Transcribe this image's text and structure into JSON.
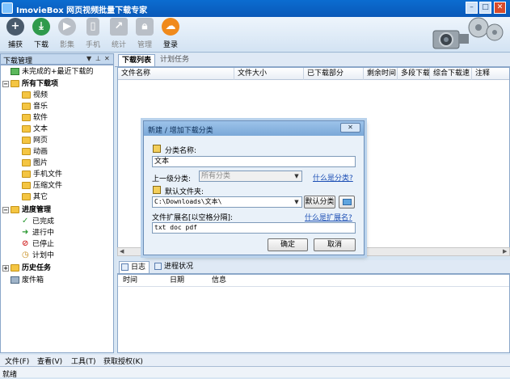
{
  "window": {
    "title": "ImovieBox 网页视频批量下载专家"
  },
  "toolbar": {
    "buttons": [
      {
        "label": "捕获",
        "icon": "plus-icon",
        "color": "#4a5a6b"
      },
      {
        "label": "下载",
        "icon": "download-icon",
        "color": "#2f9a4c"
      },
      {
        "label": "影集",
        "icon": "play-icon",
        "color": "#b9bfc7"
      },
      {
        "label": "手机",
        "icon": "phone-icon",
        "color": "#b9bfc7"
      },
      {
        "label": "统计",
        "icon": "chart-icon",
        "color": "#b9bfc7"
      },
      {
        "label": "管理",
        "icon": "lock-icon",
        "color": "#b9bfc7"
      },
      {
        "label": "登录",
        "icon": "cloud-icon",
        "color": "#f08a1c"
      }
    ]
  },
  "left_panel": {
    "title": "下载管理",
    "tree": {
      "unfinished": "未完成的+最近下载的",
      "all": "所有下载项",
      "categories": [
        "视频",
        "音乐",
        "软件",
        "文本",
        "网页",
        "动画",
        "图片",
        "手机文件",
        "压缩文件",
        "其它"
      ],
      "progress": "进度管理",
      "progress_items": [
        "已完成",
        "进行中",
        "已停止",
        "计划中"
      ],
      "history": "历史任务",
      "trash": "废件箱"
    }
  },
  "main": {
    "tabs": [
      "下载列表",
      "计划任务"
    ],
    "columns": [
      "文件名称",
      "文件大小",
      "已下载部分",
      "剩余时间",
      "多段下载",
      "综合下载速",
      "注释"
    ]
  },
  "bottom": {
    "tabs": [
      "日志",
      "进程状况"
    ],
    "columns": [
      "时间",
      "日期",
      "信息"
    ]
  },
  "menubar": [
    "文件(F)",
    "查看(V)",
    "工具(T)",
    "获取授权(K)"
  ],
  "status": "就绪",
  "dialog": {
    "title": "新建 / 增加下载分类",
    "category_name_label": "分类名称:",
    "category_name_value": "文本",
    "parent_label": "上一级分类:",
    "parent_value": "所有分类",
    "what_category_link": "什么是分类?",
    "default_folder_label": "默认文件夹:",
    "default_folder_value": "C:\\Downloads\\文本\\",
    "default_folder_button": "默认分类",
    "extensions_label": "文件扩展名[以空格分隔]:",
    "what_extension_link": "什么是扩展名?",
    "extensions_value": "txt doc pdf",
    "ok": "确定",
    "cancel": "取消"
  }
}
